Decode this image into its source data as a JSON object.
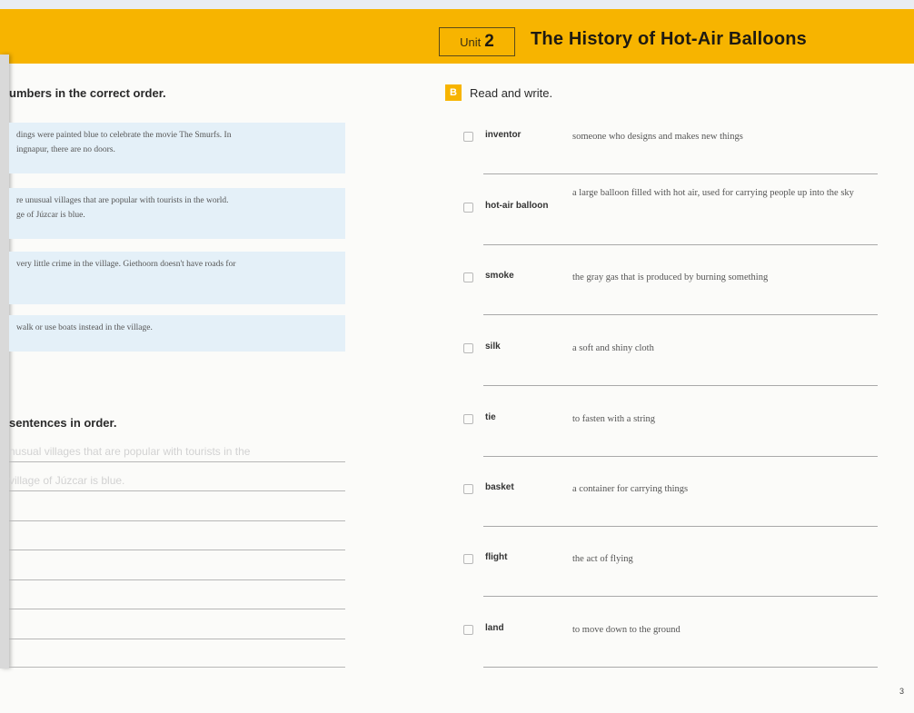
{
  "header": {
    "unit_label": "Unit",
    "unit_number": "2",
    "title": "The History of Hot-Air Balloons"
  },
  "left": {
    "instruction_1": "umbers in the correct order.",
    "boxes": [
      [
        "dings were painted blue to celebrate the movie The Smurfs. In",
        "ingnapur, there are no doors."
      ],
      [
        "re unusual villages that are popular with tourists in the world.",
        "ge of Júzcar is blue."
      ],
      [
        "very little crime in the village. Giethoorn doesn't have roads for",
        ""
      ],
      [
        "walk or use boats instead in the village.",
        ""
      ]
    ],
    "instruction_2": "sentences in order.",
    "ghost_lines": [
      "nusual villages that are popular with tourists in the",
      "village of Júzcar is blue."
    ]
  },
  "right": {
    "section_letter": "B",
    "instruction": "Read and write.",
    "vocab": [
      {
        "word": "inventor",
        "definition": "someone who designs and makes new things"
      },
      {
        "word": "hot-air balloon",
        "definition": "a large balloon filled with hot air, used for carrying people up into the sky"
      },
      {
        "word": "smoke",
        "definition": "the gray gas that is produced by burning something"
      },
      {
        "word": "silk",
        "definition": "a soft and shiny cloth"
      },
      {
        "word": "tie",
        "definition": "to fasten with a string"
      },
      {
        "word": "basket",
        "definition": "a container for carrying things"
      },
      {
        "word": "flight",
        "definition": "the act of flying"
      },
      {
        "word": "land",
        "definition": "to move down to the ground"
      }
    ]
  },
  "page_number": "3"
}
